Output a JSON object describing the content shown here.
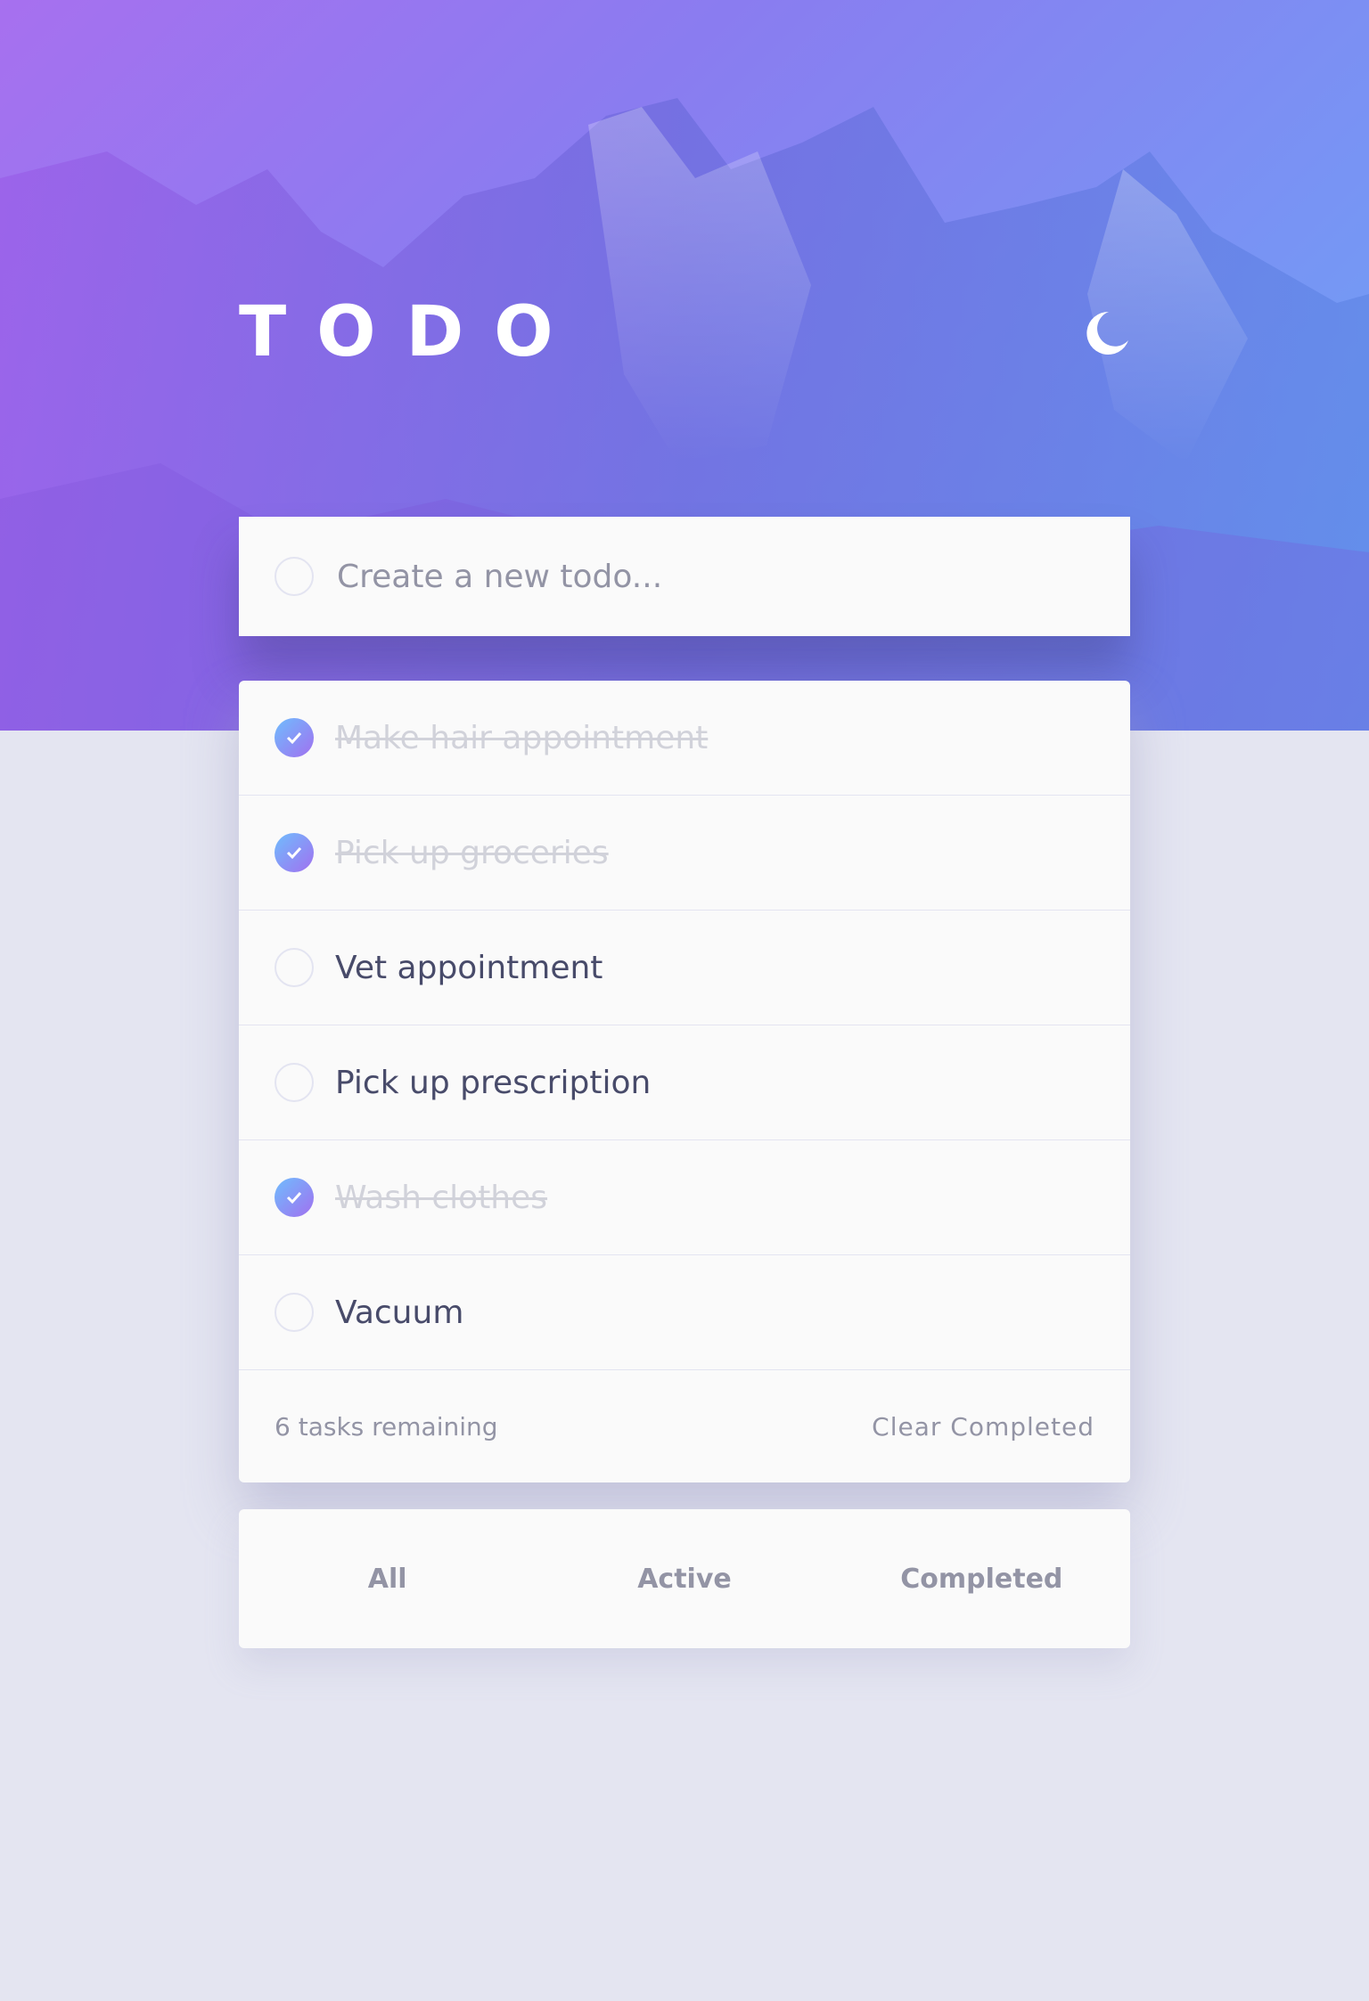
{
  "header": {
    "title": "TODO",
    "theme_icon": "moon-icon"
  },
  "new_todo": {
    "placeholder": "Create a new todo..."
  },
  "todos": [
    {
      "label": "Make hair appointment",
      "completed": true
    },
    {
      "label": "Pick up groceries",
      "completed": true
    },
    {
      "label": "Vet appointment",
      "completed": false
    },
    {
      "label": "Pick up prescription",
      "completed": false
    },
    {
      "label": "Wash clothes",
      "completed": true
    },
    {
      "label": "Vacuum",
      "completed": false
    }
  ],
  "footer": {
    "remaining": "6 tasks remaining",
    "clear_label": "Clear Completed"
  },
  "filters": {
    "all": "All",
    "active": "Active",
    "completed": "Completed"
  },
  "colors": {
    "check_gradient_start": "#6fbdfd",
    "check_gradient_end": "#a170f0",
    "background": "#e4e5f1",
    "card": "#fafafa"
  }
}
